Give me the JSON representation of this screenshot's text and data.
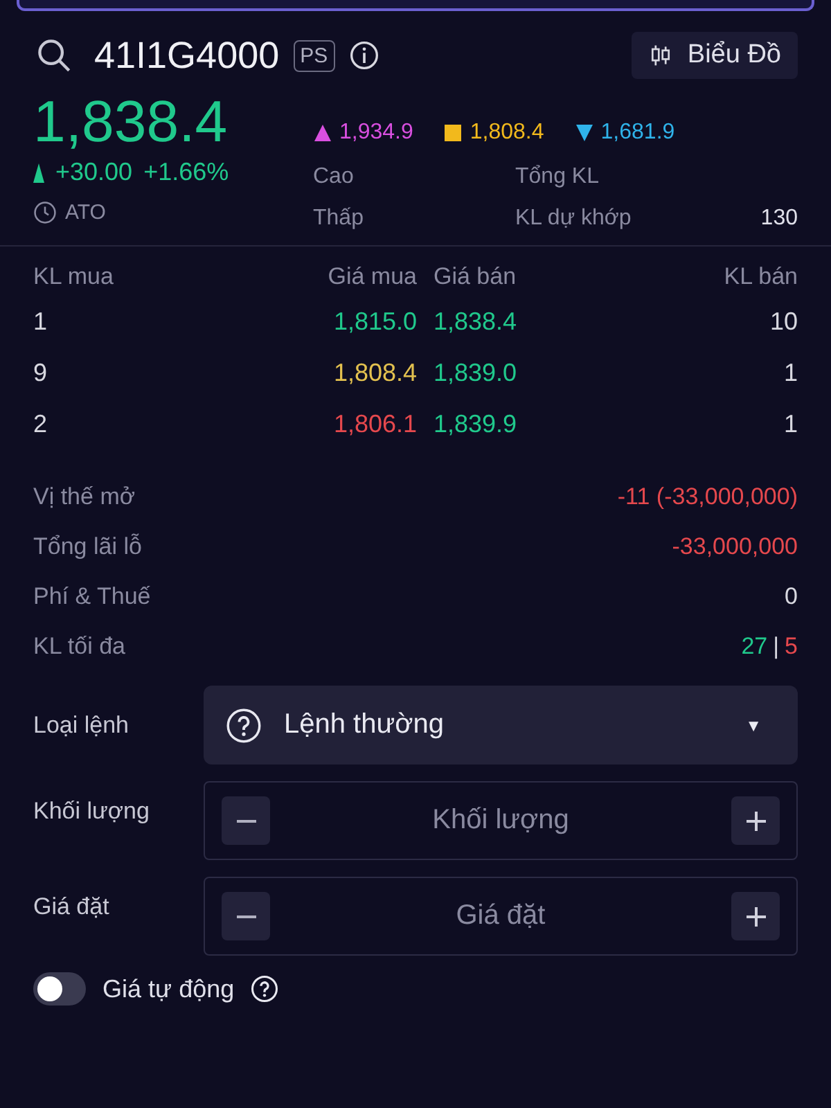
{
  "header": {
    "symbol": "41I1G4000",
    "badge": "PS",
    "chart_button": "Biểu Đồ"
  },
  "quote": {
    "price": "1,838.4",
    "change": "+30.00",
    "change_pct": "+1.66%",
    "session": "ATO",
    "ref_prices": [
      {
        "kind": "up",
        "color": "#d94fe0",
        "value": "1,934.9"
      },
      {
        "kind": "square",
        "color": "#f2b91c",
        "value": "1,808.4"
      },
      {
        "kind": "down",
        "color": "#2fb3ea",
        "value": "1,681.9"
      }
    ],
    "stats": [
      {
        "label": "Cao"
      },
      {
        "label": "Tổng KL"
      },
      {
        "label": "Thấp"
      },
      {
        "label": "KL dự khớp",
        "value": "130"
      }
    ]
  },
  "order_book": {
    "columns": [
      "KL mua",
      "Giá mua",
      "Giá bán",
      "KL bán"
    ],
    "rows": [
      {
        "bid_qty": "1",
        "bid": {
          "price": "1,815.0",
          "color": "#20c98c"
        },
        "ask": {
          "price": "1,838.4",
          "color": "#20c98c"
        },
        "ask_qty": "10"
      },
      {
        "bid_qty": "9",
        "bid": {
          "price": "1,808.4",
          "color": "#e3c14f"
        },
        "ask": {
          "price": "1,839.0",
          "color": "#20c98c"
        },
        "ask_qty": "1"
      },
      {
        "bid_qty": "2",
        "bid": {
          "price": "1,806.1",
          "color": "#e5484d"
        },
        "ask": {
          "price": "1,839.9",
          "color": "#20c98c"
        },
        "ask_qty": "1"
      }
    ]
  },
  "position": [
    {
      "label": "Vị thế mở",
      "parts": [
        {
          "text": "-11 (-33,000,000)",
          "color": "#e5484d"
        }
      ]
    },
    {
      "label": "Tổng lãi lỗ",
      "parts": [
        {
          "text": "-33,000,000",
          "color": "#e5484d"
        }
      ]
    },
    {
      "label": "Phí & Thuế",
      "parts": [
        {
          "text": "0",
          "color": "#d8d8e0"
        }
      ]
    },
    {
      "label": "KL tối đa",
      "parts": [
        {
          "text": "27",
          "color": "#20c98c"
        },
        {
          "text": "|",
          "color": "#d8d8e0"
        },
        {
          "text": "5",
          "color": "#e5484d"
        }
      ]
    }
  ],
  "form": {
    "order_type": {
      "label": "Loại lệnh",
      "value": "Lệnh thường",
      "caret": "▼"
    },
    "fields": [
      {
        "label": "Khối lượng",
        "placeholder": "Khối lượng"
      },
      {
        "label": "Giá đặt",
        "placeholder": "Giá đặt"
      }
    ],
    "auto_price": {
      "label": "Giá tự động",
      "on": false
    }
  }
}
